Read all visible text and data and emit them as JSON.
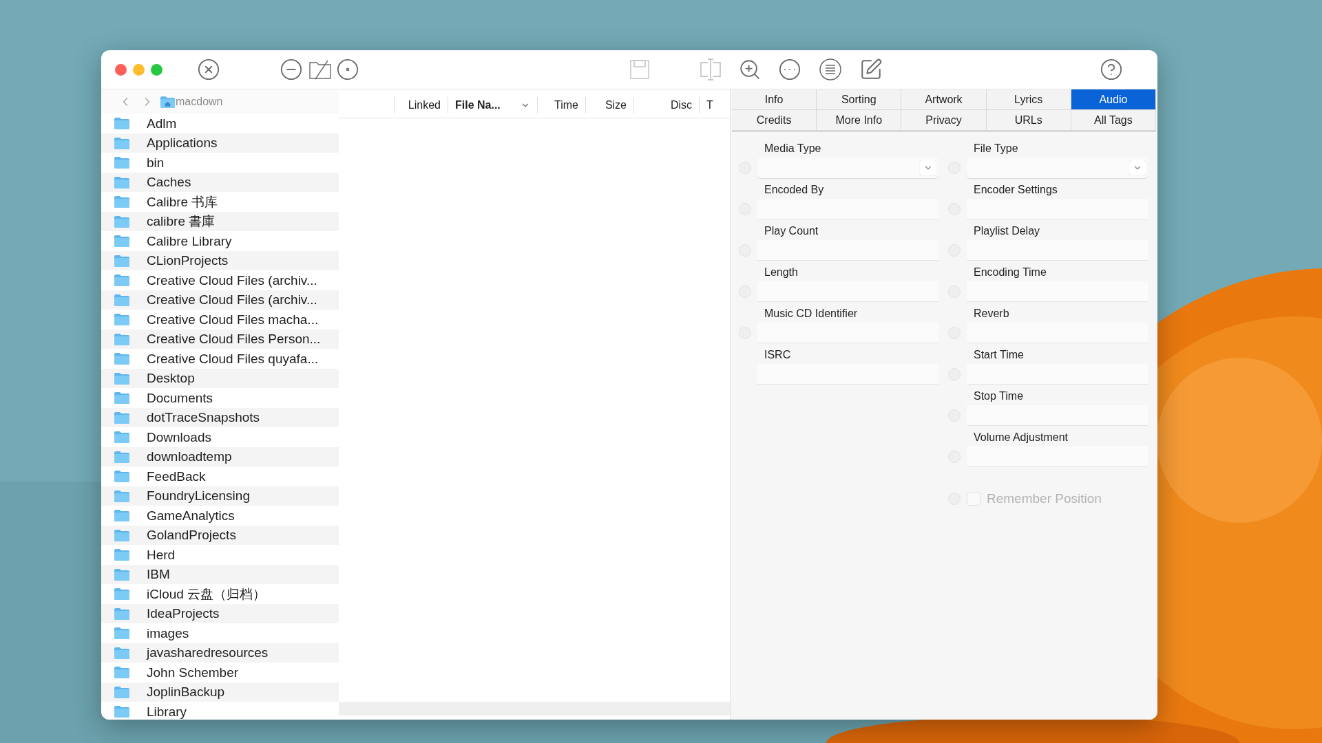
{
  "toolbar": [
    {
      "kind": "close",
      "disabled": false
    },
    {
      "kind": "minus",
      "disabled": false
    },
    {
      "kind": "folder-slash",
      "disabled": false
    },
    {
      "kind": "disc",
      "disabled": false
    },
    {
      "kind": "save",
      "disabled": true
    },
    {
      "kind": "split",
      "disabled": true
    },
    {
      "kind": "zoom",
      "disabled": false
    },
    {
      "kind": "more",
      "disabled": false
    },
    {
      "kind": "list",
      "disabled": false
    },
    {
      "kind": "edit",
      "disabled": false
    },
    {
      "kind": "help",
      "disabled": false
    }
  ],
  "path": {
    "folder": "macdown"
  },
  "sidebar": {
    "items": [
      {
        "label": "Adlm"
      },
      {
        "label": "Applications"
      },
      {
        "label": "bin"
      },
      {
        "label": "Caches"
      },
      {
        "label": "Calibre 书库"
      },
      {
        "label": "calibre 書庫"
      },
      {
        "label": "Calibre Library"
      },
      {
        "label": "CLionProjects"
      },
      {
        "label": "Creative Cloud Files (archiv..."
      },
      {
        "label": "Creative Cloud Files (archiv..."
      },
      {
        "label": "Creative Cloud Files macha..."
      },
      {
        "label": "Creative Cloud Files Person..."
      },
      {
        "label": "Creative Cloud Files quyafa..."
      },
      {
        "label": "Desktop"
      },
      {
        "label": "Documents"
      },
      {
        "label": "dotTraceSnapshots"
      },
      {
        "label": "Downloads"
      },
      {
        "label": "downloadtemp"
      },
      {
        "label": "FeedBack"
      },
      {
        "label": "FoundryLicensing"
      },
      {
        "label": "GameAnalytics"
      },
      {
        "label": "GolandProjects"
      },
      {
        "label": "Herd"
      },
      {
        "label": "IBM"
      },
      {
        "label": "iCloud 云盘（归档）"
      },
      {
        "label": "IdeaProjects"
      },
      {
        "label": "images"
      },
      {
        "label": "javasharedresources"
      },
      {
        "label": "John Schember"
      },
      {
        "label": "JoplinBackup"
      },
      {
        "label": "Library"
      }
    ]
  },
  "table": {
    "columns": [
      {
        "label": "Linked",
        "sorted": false
      },
      {
        "label": "File Na...",
        "sorted": true
      },
      {
        "label": "Time",
        "sorted": false
      },
      {
        "label": "Size",
        "sorted": false
      },
      {
        "label": "Disc",
        "sorted": false
      },
      {
        "label": "T",
        "sorted": false
      }
    ]
  },
  "tabs": [
    {
      "label": "Info",
      "selected": false
    },
    {
      "label": "Sorting",
      "selected": false
    },
    {
      "label": "Artwork",
      "selected": false
    },
    {
      "label": "Lyrics",
      "selected": false
    },
    {
      "label": "Audio",
      "selected": true
    },
    {
      "label": "Credits",
      "selected": false
    },
    {
      "label": "More Info",
      "selected": false
    },
    {
      "label": "Privacy",
      "selected": false
    },
    {
      "label": "URLs",
      "selected": false
    },
    {
      "label": "All Tags",
      "selected": false
    }
  ],
  "form": {
    "left": [
      {
        "kind": "select",
        "label": "Media Type"
      },
      {
        "kind": "text",
        "label": "Encoded By"
      },
      {
        "kind": "text",
        "label": "Play Count"
      },
      {
        "kind": "text",
        "label": "Length"
      },
      {
        "kind": "text",
        "label": "Music CD Identifier"
      },
      {
        "kind": "text-nodot",
        "label": "ISRC"
      }
    ],
    "right": [
      {
        "kind": "select",
        "label": "File Type"
      },
      {
        "kind": "text",
        "label": "Encoder Settings"
      },
      {
        "kind": "text",
        "label": "Playlist Delay"
      },
      {
        "kind": "text",
        "label": "Encoding Time"
      },
      {
        "kind": "text",
        "label": "Reverb"
      },
      {
        "kind": "text",
        "label": "Start Time"
      },
      {
        "kind": "text",
        "label": "Stop Time"
      },
      {
        "kind": "text",
        "label": "Volume Adjustment"
      }
    ],
    "checkbox": {
      "label": "Remember Position",
      "checked": false,
      "disabled": true
    }
  }
}
